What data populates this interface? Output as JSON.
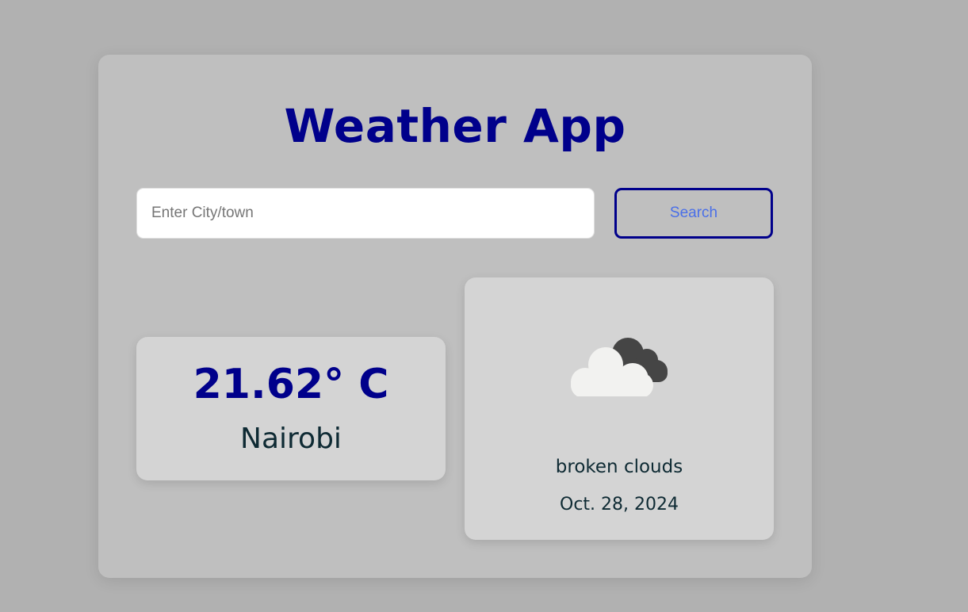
{
  "app": {
    "title": "Weather App"
  },
  "search": {
    "placeholder": "Enter City/town",
    "value": "",
    "button_label": "Search"
  },
  "current": {
    "temperature": "21.62° C",
    "city": "Nairobi"
  },
  "condition": {
    "icon": "broken-clouds-icon",
    "description": "broken clouds",
    "date": "Oct. 28, 2024"
  },
  "colors": {
    "background": "#b1b1b1",
    "card": "#bfbfbf",
    "panel": "#d4d4d4",
    "accent": "#00008b",
    "button_text": "#4a6fe8",
    "text_dark": "#0e2a33"
  }
}
